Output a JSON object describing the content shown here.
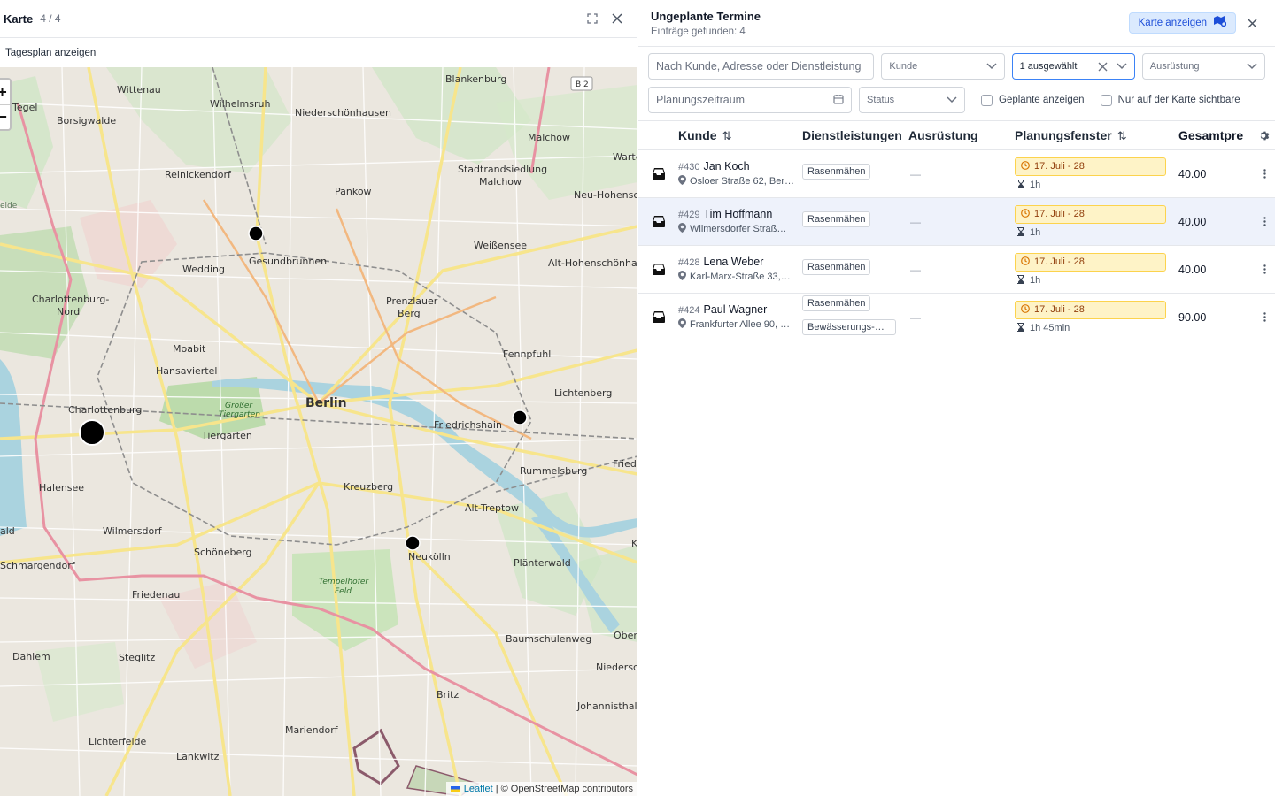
{
  "map_panel": {
    "title": "Karte",
    "count": "4 / 4",
    "day_plan_link": "Tagesplan anzeigen",
    "zoom_in": "+",
    "zoom_out": "−",
    "attribution_leaflet": "Leaflet",
    "attribution_rest": "| © OpenStreetMap contributors",
    "labels": {
      "wittenau": "Wittenau",
      "tegel": "Tegel",
      "borsigwalde": "Borsigwalde",
      "wilhelmsruh": "Wilhelmsruh",
      "niederschoenhausen": "Niederschönhausen",
      "blankenburg": "Blankenburg",
      "malchow": "Malchow",
      "reinickendorf": "Reinickendorf",
      "pankow": "Pankow",
      "stadtrandsiedlung": "Stadtrandsiedlung",
      "malchow2": "Malchow",
      "warte": "Warte",
      "neu_hohenschoe": "Neu-Hohensch",
      "weissensee": "Weißensee",
      "gesundbrunnen": "Gesundbrunnen",
      "wedding": "Wedding",
      "alt_hohenschoenhau": "Alt-Hohenschönhau",
      "charlottenburg_nord": "Charlottenburg-",
      "charlottenburg_nord2": "Nord",
      "prenzlauer": "Prenzlauer",
      "berg": "Berg",
      "moabit": "Moabit",
      "fennpfuhl": "Fennpfuhl",
      "hansaviertel": "Hansaviertel",
      "berlin": "Berlin",
      "lichtenberg": "Lichtenberg",
      "charlottenburg": "Charlottenburg",
      "grosser": "Großer",
      "tiergarten_park": "Tiergarten",
      "tiergarten": "Tiergarten",
      "friedrichshain": "Friedrichshain",
      "fried": "Fried",
      "halensee": "Halensee",
      "rummelsburg": "Rummelsburg",
      "kreuzberg": "Kreuzberg",
      "alt_treptow": "Alt-Treptow",
      "wilmersdorf": "Wilmersdorf",
      "schoeneberg": "Schöneberg",
      "neukoelln": "Neukölln",
      "schmargendorf": "Schmargendorf",
      "plaenterwald": "Plänterwald",
      "tempelhofer": "Tempelhofer",
      "feld": "Feld",
      "friedenau": "Friedenau",
      "baumschulenweg": "Baumschulenweg",
      "ober": "Ober",
      "dahlem": "Dahlem",
      "steglitz": "Steglitz",
      "niederschoe": "Niedersch",
      "britz": "Britz",
      "johannisthal": "Johannisthal",
      "mariendorf": "Mariendorf",
      "lichterfelde": "Lichterfelde",
      "lankwitz": "Lankwitz",
      "b2": "B 2",
      "eide": "eide",
      "ald": "ald",
      "k": "K"
    }
  },
  "list_panel": {
    "title": "Ungeplante Termine",
    "subtitle": "Einträge gefunden: 4",
    "show_map_button": "Karte anzeigen",
    "filters": {
      "search_placeholder": "Nach Kunde, Adresse oder Dienstleistung",
      "kunde_placeholder": "Kunde",
      "dienst_selected": "1 ausgewählt",
      "ausruestung_placeholder": "Ausrüstung",
      "zeitraum_placeholder": "Planungszeitraum",
      "status_placeholder": "Status",
      "geplante_label": "Geplante anzeigen",
      "nur_karte_label": "Nur auf der Karte sichtbare"
    },
    "columns": {
      "kunde": "Kunde",
      "dienst": "Dienstleistungen",
      "ausruestung": "Ausrüstung",
      "planungsfenster": "Planungsfenster",
      "gesamtpreis": "Gesamtpre"
    },
    "rows": [
      {
        "id": "#430",
        "name": "Jan Koch",
        "address": "Osloer Straße 62, Ber…",
        "services": [
          "Rasenmähen"
        ],
        "equipment": "—",
        "window": "17. Juli - 28",
        "duration": "1h",
        "total": "40.00"
      },
      {
        "id": "#429",
        "name": "Tim Hoffmann",
        "address": "Wilmersdorfer Straß…",
        "services": [
          "Rasenmähen"
        ],
        "equipment": "—",
        "window": "17. Juli - 28",
        "duration": "1h",
        "total": "40.00"
      },
      {
        "id": "#428",
        "name": "Lena Weber",
        "address": "Karl-Marx-Straße 33,…",
        "services": [
          "Rasenmähen"
        ],
        "equipment": "—",
        "window": "17. Juli - 28",
        "duration": "1h",
        "total": "40.00"
      },
      {
        "id": "#424",
        "name": "Paul Wagner",
        "address": "Frankfurter Allee 90, …",
        "services": [
          "Rasenmähen",
          "Bewässerungs-C…"
        ],
        "equipment": "—",
        "window": "17. Juli - 28",
        "duration": "1h 45min",
        "total": "90.00"
      }
    ]
  },
  "colors": {
    "accent": "#1d4ed8",
    "badge_bg": "#fef3c7",
    "badge_border": "#fcd34d",
    "row_highlight": "#eef2fb"
  }
}
